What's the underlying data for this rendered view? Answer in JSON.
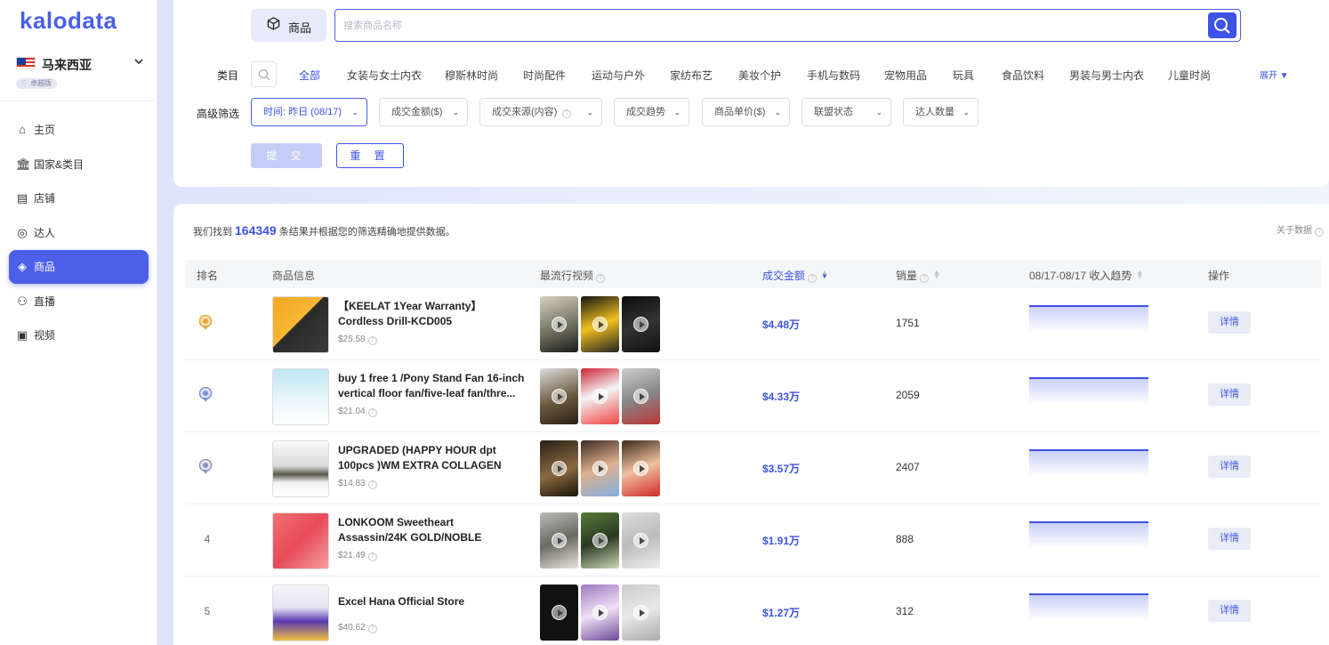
{
  "brand": {
    "logo_text": "kalodata"
  },
  "sidebar": {
    "country": "马来西亚",
    "plan_badge": "卓越版",
    "items": [
      {
        "label": "主页",
        "icon": "home-icon"
      },
      {
        "label": "国家&类目",
        "icon": "bank-icon"
      },
      {
        "label": "店铺",
        "icon": "store-icon"
      },
      {
        "label": "达人",
        "icon": "influencer-icon"
      },
      {
        "label": "商品",
        "icon": "product-box-icon",
        "active": true
      },
      {
        "label": "直播",
        "icon": "live-icon"
      },
      {
        "label": "视频",
        "icon": "video-icon"
      }
    ]
  },
  "filter": {
    "product_tab": "商品",
    "search_placeholder": "搜索商品名称",
    "category_label": "类目",
    "categories": [
      "全部",
      "女装与女士内衣",
      "穆斯林时尚",
      "时尚配件",
      "运动与户外",
      "家纺布艺",
      "美妆个护",
      "手机与数码",
      "宠物用品",
      "玩具",
      "食品饮料",
      "男装与男士内衣",
      "儿童时尚"
    ],
    "expand_label": "展开",
    "advanced_label": "高级筛选",
    "dropdowns": [
      "时间: 昨日 (08/17)",
      "成交金额($)",
      "成交来源(内容)",
      "成交趋势",
      "商品单价($)",
      "联盟状态",
      "达人数量"
    ],
    "submit_label": "提 交",
    "reset_label": "重 置"
  },
  "results": {
    "found_prefix": "我们找到",
    "found_count": "164349",
    "found_suffix": "条结果并根据您的筛选精确地提供数据。",
    "about_data": "关于数据",
    "columns": {
      "rank": "排名",
      "product_info": "商品信息",
      "popular_videos": "最流行视频",
      "gmv": "成交金额",
      "sales": "销量",
      "trend": "08/17-08/17 收入趋势",
      "action": "操作"
    },
    "rows": [
      {
        "rank": "1",
        "title": "【KEELAT 1Year Warranty】 Cordless Drill-KCD005",
        "price": "$25.58",
        "gmv": "$4.48万",
        "sales": "1751",
        "detail": "详情"
      },
      {
        "rank": "2",
        "title": "buy 1 free 1 /Pony Stand Fan 16-inch vertical floor fan/five-leaf fan/thre...",
        "price": "$21.04",
        "gmv": "$4.33万",
        "sales": "2059",
        "detail": "详情"
      },
      {
        "rank": "3",
        "title": "UPGRADED (HAPPY HOUR dpt 100pcs )WM EXTRA COLLAGEN FIRMING...",
        "price": "$14.83",
        "gmv": "$3.57万",
        "sales": "2407",
        "detail": "详情"
      },
      {
        "rank": "4",
        "title": "LONKOOM Sweetheart Assassin/24K GOLD/NOBLE GOLD/Weekend Part...",
        "price": "$21.49",
        "gmv": "$1.91万",
        "sales": "888",
        "detail": "详情"
      },
      {
        "rank": "5",
        "title": "Excel Hana Official Store",
        "price": "$40.62",
        "gmv": "$1.27万",
        "sales": "312",
        "detail": "详情"
      }
    ]
  },
  "colors": {
    "accent": "#3d52e6",
    "gold": "#e8a23a",
    "silver": "#7f8fd6"
  }
}
